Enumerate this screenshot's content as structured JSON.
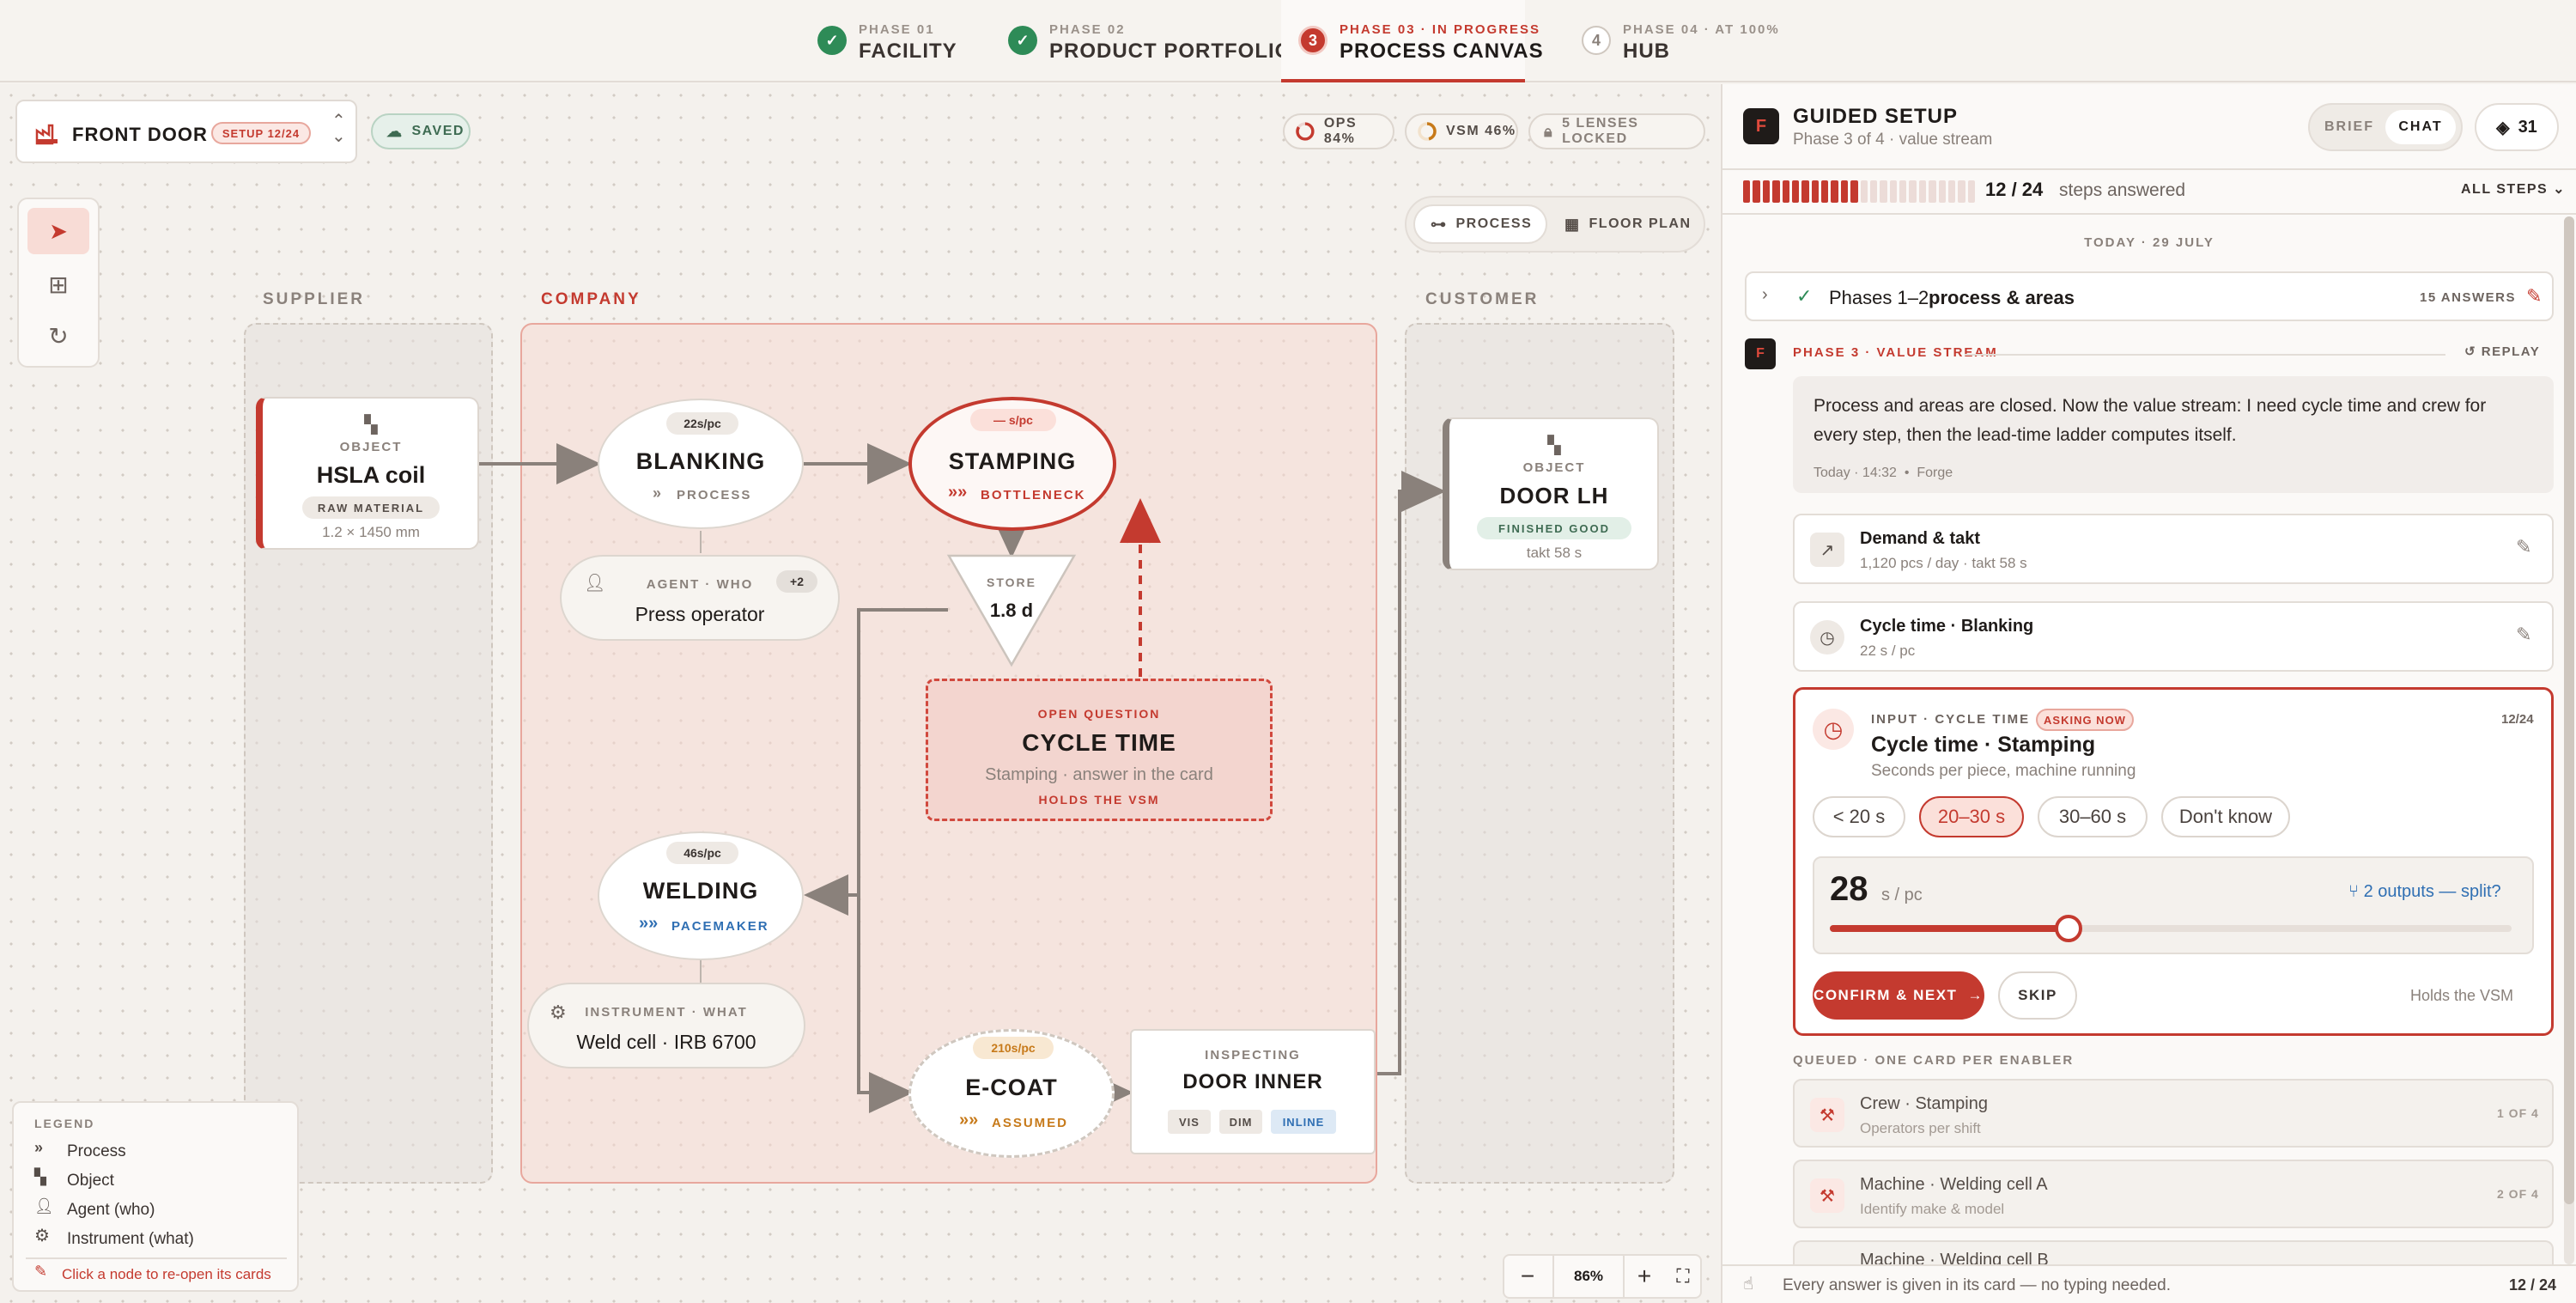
{
  "phases": [
    {
      "sup": "PHASE 01",
      "label": "FACILITY",
      "state": "done"
    },
    {
      "sup": "PHASE 02",
      "label": "PRODUCT PORTFOLIO",
      "state": "done"
    },
    {
      "sup": "PHASE 03 · IN PROGRESS",
      "label": "PROCESS CANVAS",
      "state": "active",
      "num": "3"
    },
    {
      "sup": "PHASE 04 · AT 100%",
      "label": "HUB",
      "state": "todo",
      "num": "4"
    }
  ],
  "project": {
    "name": "FRONT DOOR LH",
    "setup": "SETUP 12/24",
    "saved": "SAVED"
  },
  "status": {
    "ops": "OPS 84%",
    "vsm": "VSM 46%",
    "lenses": "5 LENSES LOCKED"
  },
  "view_toggle": {
    "process": "PROCESS",
    "floor_plan": "FLOOR PLAN"
  },
  "zones": {
    "supplier": "SUPPLIER",
    "company": "COMPANY",
    "customer": "CUSTOMER"
  },
  "nodes": {
    "hsla": {
      "kind": "OBJECT",
      "title": "HSLA coil",
      "tag": "RAW MATERIAL",
      "sub": "1.2 × 1450 mm"
    },
    "blanking": {
      "rate": "22s/pc",
      "title": "BLANKING",
      "tag": "PROCESS"
    },
    "operator": {
      "kind": "AGENT · WHO",
      "title": "Press operator",
      "badge": "+2"
    },
    "stamping": {
      "rate": "— s/pc",
      "title": "STAMPING",
      "tag": "BOTTLENECK"
    },
    "store": {
      "kind": "STORE",
      "value": "1.8 d"
    },
    "question": {
      "kind": "OPEN QUESTION",
      "title": "CYCLE TIME",
      "sub": "Stamping · answer in the card",
      "tag": "HOLDS THE VSM"
    },
    "welding": {
      "rate": "46s/pc",
      "title": "WELDING",
      "tag": "PACEMAKER"
    },
    "weldcell": {
      "kind": "INSTRUMENT · WHAT",
      "title": "Weld cell · IRB 6700"
    },
    "ecoat": {
      "rate": "210s/pc",
      "title": "E-COAT",
      "tag": "ASSUMED"
    },
    "inspect": {
      "kind": "INSPECTING",
      "title": "DOOR INNER",
      "chips": [
        "VIS",
        "DIM",
        "INLINE"
      ]
    },
    "doorlh": {
      "kind": "OBJECT",
      "title": "DOOR LH",
      "tag": "FINISHED GOOD",
      "sub": "takt 58 s"
    }
  },
  "legend": {
    "title": "LEGEND",
    "items": [
      "Process",
      "Object",
      "Agent (who)",
      "Instrument (what)"
    ],
    "hint": "Click a node to re-open its cards"
  },
  "zoom": {
    "value": "86%"
  },
  "panel": {
    "title": "GUIDED SETUP",
    "subtitle": "Phase 3 of 4 · value stream",
    "tabs": [
      "BRIEF",
      "CHAT"
    ],
    "count": "31",
    "progress": {
      "answered": "12 / 24",
      "label": "steps answered",
      "filter": "ALL STEPS",
      "fraction": 0.5
    },
    "date": "TODAY · 29 JULY",
    "summary": {
      "title": "Phases 1–2",
      "subtitle": "process & areas",
      "answers": "15 ANSWERS"
    },
    "phase_label": "PHASE 3 · VALUE STREAM",
    "replay": "REPLAY",
    "message": {
      "text": "Process and areas are closed. Now the value stream: I need cycle time and crew for every step, then the lead-time ladder computes itself.",
      "time": "Today · 14:32",
      "author": "Forge"
    },
    "answered": [
      {
        "title": "Demand & takt",
        "sub": "1,120 pcs / day · takt 58 s"
      },
      {
        "title": "Cycle time · Blanking",
        "sub": "22 s / pc"
      }
    ],
    "input": {
      "kind": "INPUT · CYCLE TIME",
      "badge": "ASKING NOW",
      "step": "12/24",
      "title": "Cycle time · Stamping",
      "sub": "Seconds per piece, machine running",
      "options": [
        "< 20 s",
        "20–30 s",
        "30–60 s",
        "Don't know"
      ],
      "value": "28",
      "unit": "s / pc",
      "split": "2 outputs — split?",
      "slider": 0.35,
      "confirm": "CONFIRM & NEXT",
      "skip": "SKIP",
      "holds": "Holds the VSM"
    },
    "queued_label": "QUEUED · ONE CARD PER ENABLER",
    "queued": [
      {
        "title": "Crew · Stamping",
        "sub": "Operators per shift",
        "pos": "1 OF 4"
      },
      {
        "title": "Machine · Welding cell A",
        "sub": "Identify make & model",
        "pos": "2 OF 4"
      },
      {
        "title": "Machine · Welding cell B",
        "sub": "",
        "pos": ""
      }
    ],
    "footer": {
      "text": "Every answer is given in its card — no typing needed.",
      "count": "12 / 24"
    }
  },
  "colors": {
    "accent": "#c43a2f",
    "done": "#2e8b57",
    "pacemaker": "#2f6fb3",
    "assumed": "#c77a1a"
  }
}
